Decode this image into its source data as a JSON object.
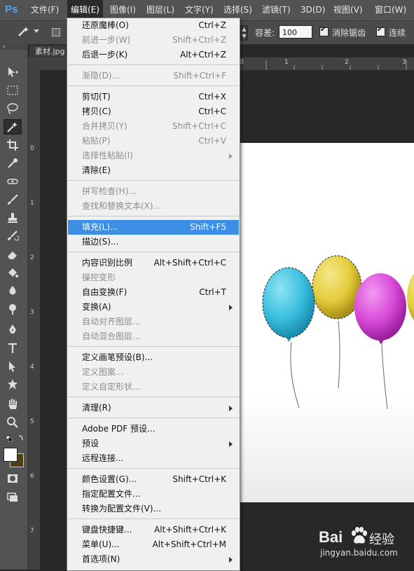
{
  "app": {
    "logo": "Ps"
  },
  "menubar": {
    "items": [
      {
        "label": "文件(F)"
      },
      {
        "label": "编辑(E)"
      },
      {
        "label": "图像(I)"
      },
      {
        "label": "图层(L)"
      },
      {
        "label": "文字(Y)"
      },
      {
        "label": "选择(S)"
      },
      {
        "label": "滤镜(T)"
      },
      {
        "label": "3D(D)"
      },
      {
        "label": "视图(V)"
      },
      {
        "label": "窗口(W)"
      }
    ]
  },
  "options": {
    "tolerance_label": "容差:",
    "tolerance_value": "100",
    "antialias_label": "消除锯齿",
    "contiguous_label": "连续"
  },
  "document": {
    "tab_label": "素材.jpg"
  },
  "rulers": {
    "h": [
      "0",
      "1",
      "2",
      "3"
    ],
    "v": [
      "0",
      "1",
      "2",
      "3",
      "4",
      "5",
      "6",
      "7"
    ]
  },
  "edit_menu": {
    "items": [
      {
        "label": "还原魔棒(O)",
        "shortcut": "Ctrl+Z",
        "disabled": false
      },
      {
        "label": "前进一步(W)",
        "shortcut": "Shift+Ctrl+Z",
        "disabled": true
      },
      {
        "label": "后退一步(K)",
        "shortcut": "Alt+Ctrl+Z",
        "disabled": false
      },
      {
        "label": "渐隐(D)...",
        "shortcut": "Shift+Ctrl+F",
        "disabled": true
      },
      {
        "label": "剪切(T)",
        "shortcut": "Ctrl+X",
        "disabled": false
      },
      {
        "label": "拷贝(C)",
        "shortcut": "Ctrl+C",
        "disabled": false
      },
      {
        "label": "合并拷贝(Y)",
        "shortcut": "Shift+Ctrl+C",
        "disabled": true
      },
      {
        "label": "粘贴(P)",
        "shortcut": "Ctrl+V",
        "disabled": true
      },
      {
        "label": "选择性粘贴(I)",
        "shortcut": "",
        "disabled": true,
        "submenu": true
      },
      {
        "label": "清除(E)",
        "shortcut": "",
        "disabled": false
      },
      {
        "label": "拼写检查(H)...",
        "shortcut": "",
        "disabled": true
      },
      {
        "label": "查找和替换文本(X)...",
        "shortcut": "",
        "disabled": true
      },
      {
        "label": "填充(L)...",
        "shortcut": "Shift+F5",
        "disabled": false,
        "highlighted": true
      },
      {
        "label": "描边(S)...",
        "shortcut": "",
        "disabled": false
      },
      {
        "label": "内容识别比例",
        "shortcut": "Alt+Shift+Ctrl+C",
        "disabled": false
      },
      {
        "label": "操控变形",
        "shortcut": "",
        "disabled": true
      },
      {
        "label": "自由变换(F)",
        "shortcut": "Ctrl+T",
        "disabled": false
      },
      {
        "label": "变换(A)",
        "shortcut": "",
        "disabled": false,
        "submenu": true
      },
      {
        "label": "自动对齐图层...",
        "shortcut": "",
        "disabled": true
      },
      {
        "label": "自动混合图层...",
        "shortcut": "",
        "disabled": true
      },
      {
        "label": "定义画笔预设(B)...",
        "shortcut": "",
        "disabled": false
      },
      {
        "label": "定义图案...",
        "shortcut": "",
        "disabled": true
      },
      {
        "label": "定义自定形状...",
        "shortcut": "",
        "disabled": true
      },
      {
        "label": "清理(R)",
        "shortcut": "",
        "disabled": false,
        "submenu": true
      },
      {
        "label": "Adobe PDF 预设...",
        "shortcut": "",
        "disabled": false
      },
      {
        "label": "预设",
        "shortcut": "",
        "disabled": false,
        "submenu": true
      },
      {
        "label": "远程连接...",
        "shortcut": "",
        "disabled": false
      },
      {
        "label": "颜色设置(G)...",
        "shortcut": "Shift+Ctrl+K",
        "disabled": false
      },
      {
        "label": "指定配置文件...",
        "shortcut": "",
        "disabled": false
      },
      {
        "label": "转换为配置文件(V)...",
        "shortcut": "",
        "disabled": false
      },
      {
        "label": "键盘快捷键...",
        "shortcut": "Alt+Shift+Ctrl+K",
        "disabled": false
      },
      {
        "label": "菜单(U)...",
        "shortcut": "Alt+Shift+Ctrl+M",
        "disabled": false
      },
      {
        "label": "首选项(N)",
        "shortcut": "",
        "disabled": false,
        "submenu": true
      }
    ]
  },
  "watermark": {
    "brand": "Bai",
    "brand_suffix": "经验",
    "url": "jingyan.baidu.com"
  },
  "colors": {
    "highlight": "#3d8ee5",
    "balloon_cyan": "#3cc0e0",
    "balloon_yellow": "#e3cc3c",
    "balloon_magenta": "#d84ad8"
  },
  "tools": [
    "move-tool-icon",
    "marquee-tool-icon",
    "lasso-tool-icon",
    "magic-wand-tool-icon",
    "crop-tool-icon",
    "eyedropper-tool-icon",
    "healing-brush-icon",
    "brush-tool-icon",
    "clone-stamp-icon",
    "history-brush-icon",
    "eraser-tool-icon",
    "paint-bucket-icon",
    "blur-tool-icon",
    "dodge-tool-icon",
    "pen-tool-icon",
    "type-tool-icon",
    "path-selection-icon",
    "shape-tool-icon",
    "hand-tool-icon",
    "zoom-tool-icon"
  ]
}
